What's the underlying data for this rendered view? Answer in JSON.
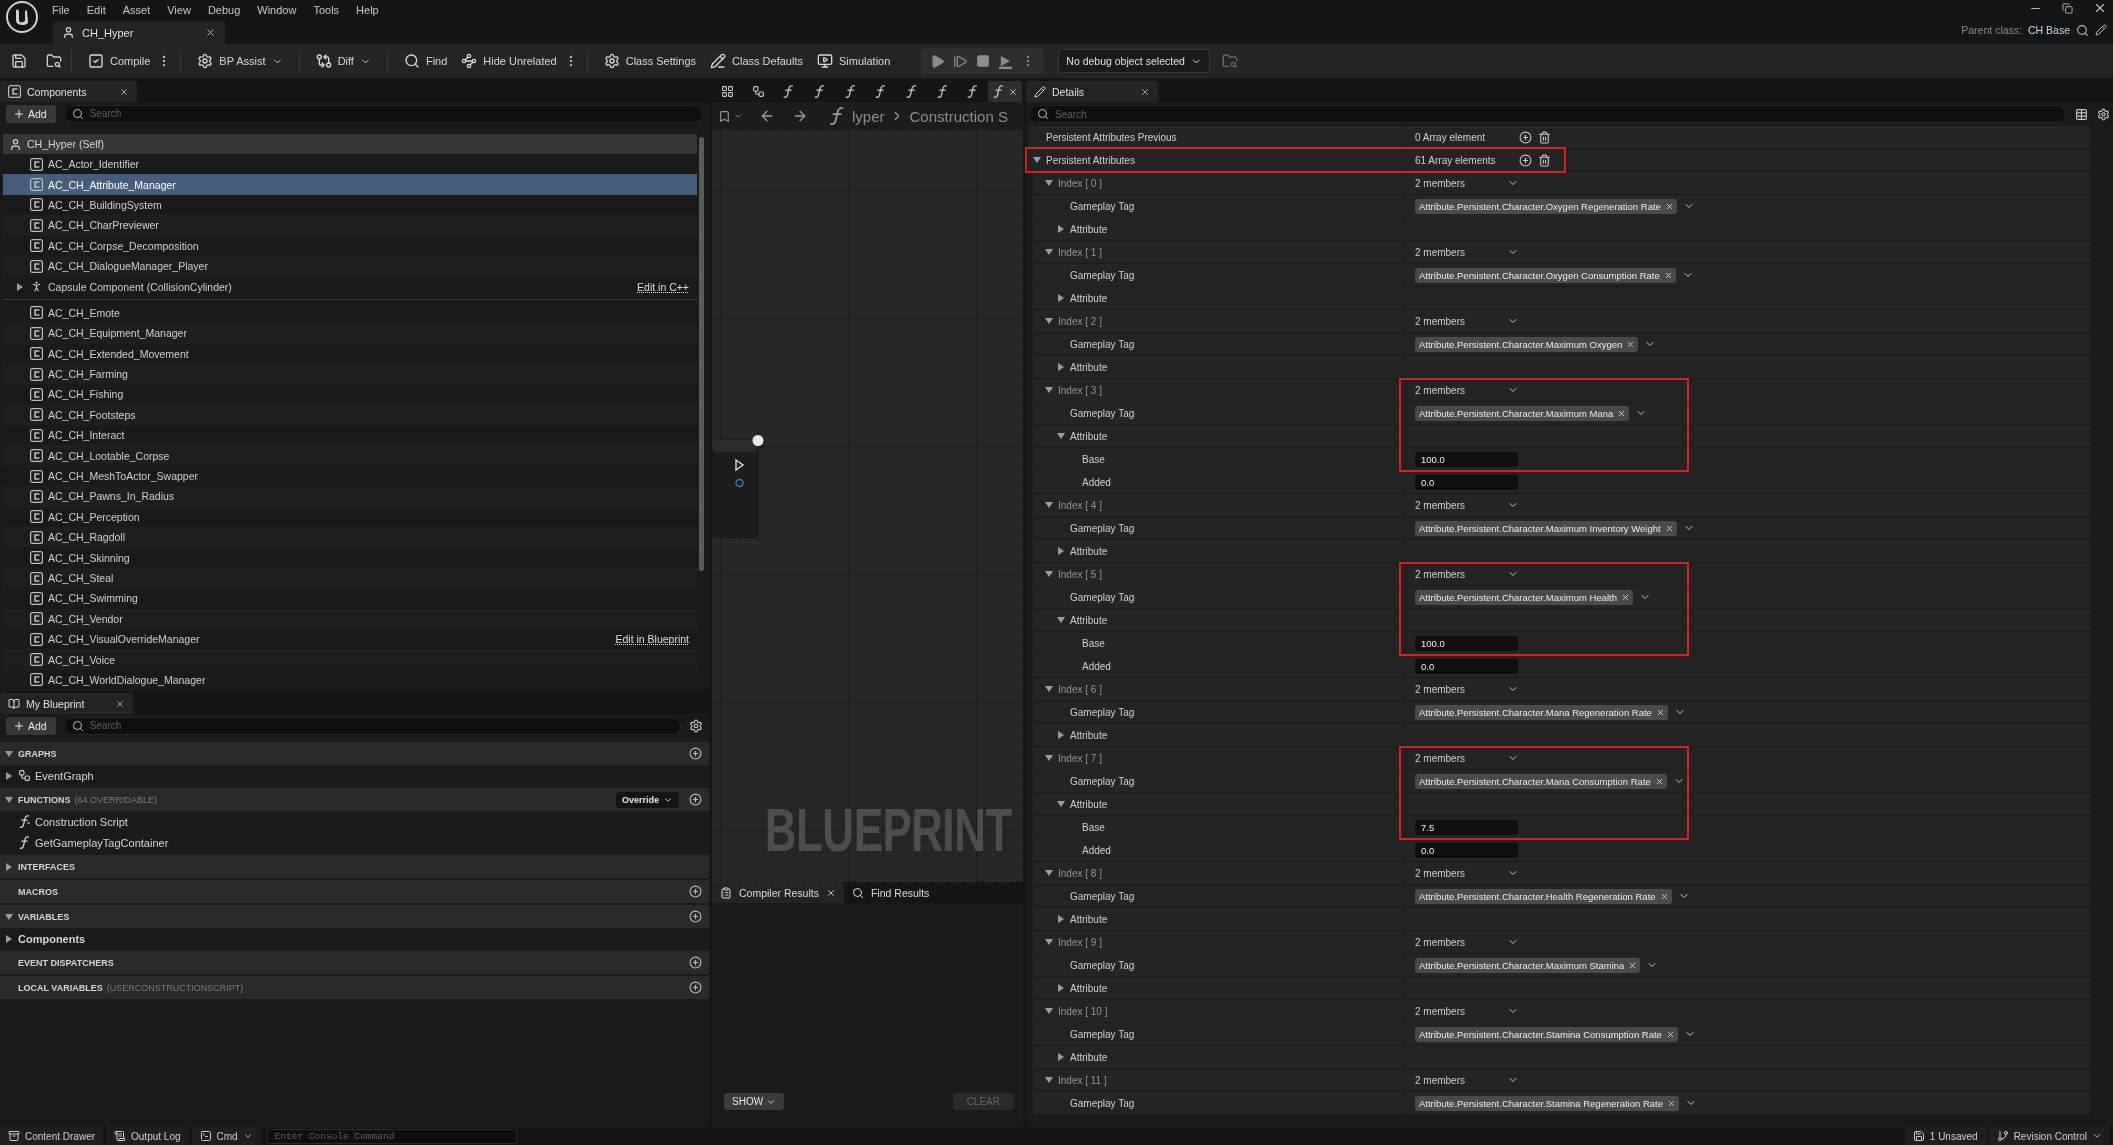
{
  "title_bar": {
    "menu": [
      "File",
      "Edit",
      "Asset",
      "View",
      "Debug",
      "Window",
      "Tools",
      "Help"
    ],
    "document_tab": {
      "title": "CH_Hyper"
    },
    "parent_class": {
      "label": "Parent class:",
      "value": "CH Base"
    }
  },
  "toolbar": {
    "groups": [
      {
        "buttons": [
          {
            "label": "Compile",
            "dropdown": false
          }
        ],
        "more_menu": true
      },
      {
        "buttons": [
          {
            "label": "BP Assist",
            "dropdown": true
          }
        ],
        "more_menu": false
      },
      {
        "buttons": [
          {
            "label": "Diff",
            "dropdown": true
          }
        ],
        "more_menu": false
      },
      {
        "buttons": [
          {
            "label": "Find",
            "dropdown": false
          },
          {
            "label": "Hide Unrelated",
            "dropdown": false
          }
        ],
        "more_menu": true
      },
      {
        "buttons": [
          {
            "label": "Class Settings",
            "dropdown": false
          },
          {
            "label": "Class Defaults",
            "dropdown": false
          },
          {
            "label": "Simulation",
            "dropdown": false
          }
        ],
        "more_menu": false
      }
    ],
    "debug_selector": {
      "value": "No debug object selected"
    }
  },
  "components_panel": {
    "tab": "Components",
    "add_button": "Add",
    "search": {
      "placeholder": "Search"
    },
    "root": {
      "label": "CH_Hyper (Self)"
    },
    "sections": [
      {
        "items": [
          {
            "label": "AC_Actor_Identifier",
            "kind": "actor",
            "selected": false
          },
          {
            "label": "AC_CH_Attribute_Manager",
            "kind": "actor",
            "selected": true
          },
          {
            "label": "AC_CH_BuildingSystem",
            "kind": "actor",
            "selected": false
          },
          {
            "label": "AC_CH_CharPreviewer",
            "kind": "actor",
            "selected": false
          },
          {
            "label": "AC_CH_Corpse_Decomposition",
            "kind": "actor",
            "selected": false
          },
          {
            "label": "AC_CH_DialogueManager_Player",
            "kind": "actor",
            "selected": false
          },
          {
            "label": "Capsule Component (CollisionCylinder)",
            "kind": "scene",
            "expanded": false,
            "selected": false,
            "link": "Edit in C++"
          }
        ]
      },
      {
        "items": [
          {
            "label": "AC_CH_Emote",
            "kind": "actor",
            "selected": false
          },
          {
            "label": "AC_CH_Equipment_Manager",
            "kind": "actor",
            "selected": false
          },
          {
            "label": "AC_CH_Extended_Movement",
            "kind": "actor",
            "selected": false
          },
          {
            "label": "AC_CH_Farming",
            "kind": "actor",
            "selected": false
          },
          {
            "label": "AC_CH_Fishing",
            "kind": "actor",
            "selected": false
          },
          {
            "label": "AC_CH_Footsteps",
            "kind": "actor",
            "selected": false
          },
          {
            "label": "AC_CH_Interact",
            "kind": "actor",
            "selected": false
          },
          {
            "label": "AC_CH_Lootable_Corpse",
            "kind": "actor",
            "selected": false
          },
          {
            "label": "AC_CH_MeshToActor_Swapper",
            "kind": "actor",
            "selected": false
          },
          {
            "label": "AC_CH_Pawns_In_Radius",
            "kind": "actor",
            "selected": false
          },
          {
            "label": "AC_CH_Perception",
            "kind": "actor",
            "selected": false
          },
          {
            "label": "AC_CH_Ragdoll",
            "kind": "actor",
            "selected": false
          },
          {
            "label": "AC_CH_Skinning",
            "kind": "actor",
            "selected": false
          },
          {
            "label": "AC_CH_Steal",
            "kind": "actor",
            "selected": false
          },
          {
            "label": "AC_CH_Swimming",
            "kind": "actor",
            "selected": false
          },
          {
            "label": "AC_CH_Vendor",
            "kind": "actor",
            "selected": false
          },
          {
            "label": "AC_CH_VisualOverrideManager",
            "kind": "actor",
            "selected": false,
            "link": "Edit in Blueprint"
          },
          {
            "label": "AC_CH_Voice",
            "kind": "actor",
            "selected": false
          },
          {
            "label": "AC_CH_WorldDialogue_Manager",
            "kind": "actor",
            "selected": false
          }
        ]
      }
    ]
  },
  "my_blueprint": {
    "tab": "My Blueprint",
    "add_button": "Add",
    "search": {
      "placeholder": "Search"
    },
    "sections": [
      {
        "title": "GRAPHS",
        "expanded": true,
        "add": true,
        "items": [
          {
            "label": "EventGraph",
            "kind": "graph",
            "expanded": false
          }
        ]
      },
      {
        "title": "FUNCTIONS",
        "note": "(64 OVERRIDABLE)",
        "expanded": true,
        "override_button": "Override",
        "add": true,
        "items": [
          {
            "label": "Construction Script",
            "kind": "construction"
          },
          {
            "label": "GetGameplayTagContainer",
            "kind": "function"
          }
        ]
      },
      {
        "title": "INTERFACES",
        "expanded": false,
        "add": false
      },
      {
        "title": "MACROS",
        "add": true
      },
      {
        "title": "VARIABLES",
        "expanded": true,
        "add": true,
        "items": [
          {
            "label": "Components",
            "kind": "category",
            "expanded": false
          }
        ]
      },
      {
        "title": "EVENT DISPATCHERS",
        "add": true
      },
      {
        "title": "LOCAL VARIABLES",
        "note": "(USERCONSTRUCTIONSCRIPT)",
        "add": true
      }
    ]
  },
  "graph_editor": {
    "tabs": [
      {
        "kind": "grid",
        "selected": false
      },
      {
        "kind": "graph",
        "selected": false
      },
      {
        "kind": "function",
        "selected": false
      },
      {
        "kind": "function",
        "selected": false
      },
      {
        "kind": "function",
        "selected": false
      },
      {
        "kind": "function",
        "selected": false
      },
      {
        "kind": "function",
        "selected": false
      },
      {
        "kind": "function",
        "selected": false
      },
      {
        "kind": "function",
        "selected": false
      },
      {
        "kind": "function",
        "selected": true
      }
    ],
    "breadcrumb": [
      "lyper",
      "Construction S"
    ],
    "corner_label": "BLUEPRINT"
  },
  "compiler_panel": {
    "tabs": [
      {
        "label": "Compiler Results",
        "selected": true
      },
      {
        "label": "Find Results",
        "selected": false
      }
    ],
    "show_button": {
      "label": "SHOW"
    },
    "clear_button": {
      "label": "CLEAR",
      "disabled": true
    }
  },
  "details_panel": {
    "tab": "Details",
    "search": {
      "placeholder": "Search"
    },
    "properties": [
      {
        "name": "Persistent Attributes Previous",
        "summary": "0 Array element",
        "highlighted": false
      },
      {
        "name": "Persistent Attributes",
        "summary": "61 Array elements",
        "expanded": true,
        "highlighted": true,
        "elements": [
          {
            "label": "Index [ 0 ]",
            "summary": "2 members",
            "expanded": true,
            "highlighted": false,
            "tag": {
              "label": "Gameplay Tag",
              "value": "Attribute.Persistent.Character.Oxygen Regeneration Rate"
            },
            "attribute": {
              "label": "Attribute",
              "expanded": false
            }
          },
          {
            "label": "Index [ 1 ]",
            "summary": "2 members",
            "expanded": true,
            "highlighted": false,
            "tag": {
              "label": "Gameplay Tag",
              "value": "Attribute.Persistent.Character.Oxygen Consumption Rate"
            },
            "attribute": {
              "label": "Attribute",
              "expanded": false
            }
          },
          {
            "label": "Index [ 2 ]",
            "summary": "2 members",
            "expanded": true,
            "highlighted": false,
            "tag": {
              "label": "Gameplay Tag",
              "value": "Attribute.Persistent.Character.Maximum Oxygen"
            },
            "attribute": {
              "label": "Attribute",
              "expanded": false
            }
          },
          {
            "label": "Index [ 3 ]",
            "summary": "2 members",
            "expanded": true,
            "highlighted": true,
            "tag": {
              "label": "Gameplay Tag",
              "value": "Attribute.Persistent.Character.Maximum Mana"
            },
            "attribute": {
              "label": "Attribute",
              "expanded": true,
              "fields": [
                {
                  "label": "Base",
                  "value": "100.0"
                },
                {
                  "label": "Added",
                  "value": "0.0"
                }
              ]
            }
          },
          {
            "label": "Index [ 4 ]",
            "summary": "2 members",
            "expanded": true,
            "highlighted": false,
            "tag": {
              "label": "Gameplay Tag",
              "value": "Attribute.Persistent.Character.Maximum Inventory Weight"
            },
            "attribute": {
              "label": "Attribute",
              "expanded": false
            }
          },
          {
            "label": "Index [ 5 ]",
            "summary": "2 members",
            "expanded": true,
            "highlighted": true,
            "tag": {
              "label": "Gameplay Tag",
              "value": "Attribute.Persistent.Character.Maximum Health"
            },
            "attribute": {
              "label": "Attribute",
              "expanded": true,
              "fields": [
                {
                  "label": "Base",
                  "value": "100.0"
                },
                {
                  "label": "Added",
                  "value": "0.0"
                }
              ]
            }
          },
          {
            "label": "Index [ 6 ]",
            "summary": "2 members",
            "expanded": true,
            "highlighted": false,
            "tag": {
              "label": "Gameplay Tag",
              "value": "Attribute.Persistent.Character.Mana Regeneration Rate"
            },
            "attribute": {
              "label": "Attribute",
              "expanded": false
            }
          },
          {
            "label": "Index [ 7 ]",
            "summary": "2 members",
            "expanded": true,
            "highlighted": true,
            "tag": {
              "label": "Gameplay Tag",
              "value": "Attribute.Persistent.Character.Mana Consumption Rate"
            },
            "attribute": {
              "label": "Attribute",
              "expanded": true,
              "fields": [
                {
                  "label": "Base",
                  "value": "7.5"
                },
                {
                  "label": "Added",
                  "value": "0.0"
                }
              ]
            }
          },
          {
            "label": "Index [ 8 ]",
            "summary": "2 members",
            "expanded": true,
            "highlighted": false,
            "tag": {
              "label": "Gameplay Tag",
              "value": "Attribute.Persistent.Character.Health Regeneration Rate"
            },
            "attribute": {
              "label": "Attribute",
              "expanded": false
            }
          },
          {
            "label": "Index [ 9 ]",
            "summary": "2 members",
            "expanded": true,
            "highlighted": false,
            "tag": {
              "label": "Gameplay Tag",
              "value": "Attribute.Persistent.Character.Maximum Stamina"
            },
            "attribute": {
              "label": "Attribute",
              "expanded": false
            }
          },
          {
            "label": "Index [ 10 ]",
            "summary": "2 members",
            "expanded": true,
            "highlighted": false,
            "tag": {
              "label": "Gameplay Tag",
              "value": "Attribute.Persistent.Character.Stamina Consumption Rate"
            },
            "attribute": {
              "label": "Attribute",
              "expanded": false
            }
          },
          {
            "label": "Index [ 11 ]",
            "summary": "2 members",
            "expanded": true,
            "highlighted": false,
            "tag": {
              "label": "Gameplay Tag",
              "value": "Attribute.Persistent.Character.Stamina Regeneration Rate"
            }
          }
        ]
      }
    ]
  },
  "status_bar": {
    "left": [
      {
        "label": "Content Drawer",
        "dropdown": false
      },
      {
        "label": "Output Log",
        "dropdown": false
      },
      {
        "label": "Cmd",
        "dropdown": true
      }
    ],
    "console": {
      "placeholder": "Enter Console Command"
    },
    "right": [
      {
        "label": "1 Unsaved",
        "dropdown": false
      },
      {
        "label": "Revision Control",
        "dropdown": true
      }
    ]
  }
}
